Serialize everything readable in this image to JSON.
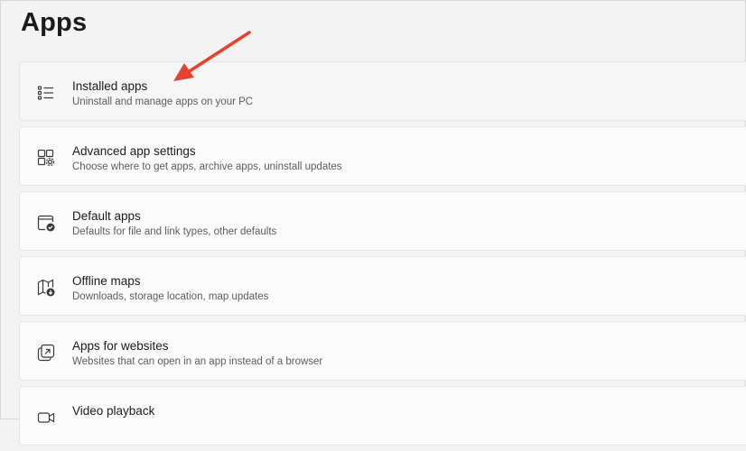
{
  "page": {
    "title": "Apps"
  },
  "settings": {
    "items": [
      {
        "icon": "installed-apps-icon",
        "title": "Installed apps",
        "subtitle": "Uninstall and manage apps on your PC"
      },
      {
        "icon": "advanced-app-settings-icon",
        "title": "Advanced app settings",
        "subtitle": "Choose where to get apps, archive apps, uninstall updates"
      },
      {
        "icon": "default-apps-icon",
        "title": "Default apps",
        "subtitle": "Defaults for file and link types, other defaults"
      },
      {
        "icon": "offline-maps-icon",
        "title": "Offline maps",
        "subtitle": "Downloads, storage location, map updates"
      },
      {
        "icon": "apps-for-websites-icon",
        "title": "Apps for websites",
        "subtitle": "Websites that can open in an app instead of a browser"
      },
      {
        "icon": "video-playback-icon",
        "title": "Video playback",
        "subtitle": ""
      }
    ]
  },
  "annotation": {
    "arrow_color": "#e8412c",
    "target": "Installed apps"
  }
}
